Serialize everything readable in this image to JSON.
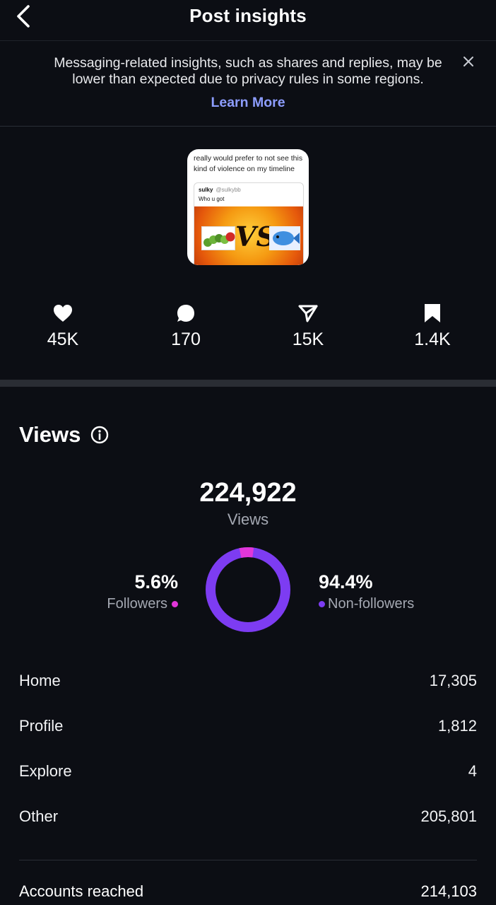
{
  "header": {
    "title": "Post insights"
  },
  "notice": {
    "text": "Messaging-related insights, such as shares and replies, may be lower than expected due to privacy rules in some regions.",
    "link_label": "Learn More"
  },
  "post_thumbnail": {
    "caption": "really would prefer to not see this kind of violence on my timeline",
    "tweet_user": "sulky",
    "tweet_handle": "@sulkybb",
    "tweet_text": "Who u got",
    "vs_label": "VS"
  },
  "stats": [
    {
      "icon": "heart-icon",
      "value": "45K"
    },
    {
      "icon": "comment-icon",
      "value": "170"
    },
    {
      "icon": "share-icon",
      "value": "15K"
    },
    {
      "icon": "bookmark-icon",
      "value": "1.4K"
    }
  ],
  "views": {
    "heading": "Views",
    "total": "224,922",
    "total_label": "Views",
    "followers_pct": "5.6%",
    "followers_label": "Followers",
    "nonfollowers_pct": "94.4%",
    "nonfollowers_label": "Non-followers",
    "followers_fraction": 0.056,
    "followers_color": "#e236d9",
    "nonfollowers_color": "#7d3cf2"
  },
  "sources": [
    {
      "label": "Home",
      "value": "17,305"
    },
    {
      "label": "Profile",
      "value": "1,812"
    },
    {
      "label": "Explore",
      "value": "4"
    },
    {
      "label": "Other",
      "value": "205,801"
    }
  ],
  "accounts_reached": {
    "label": "Accounts reached",
    "value": "214,103"
  }
}
